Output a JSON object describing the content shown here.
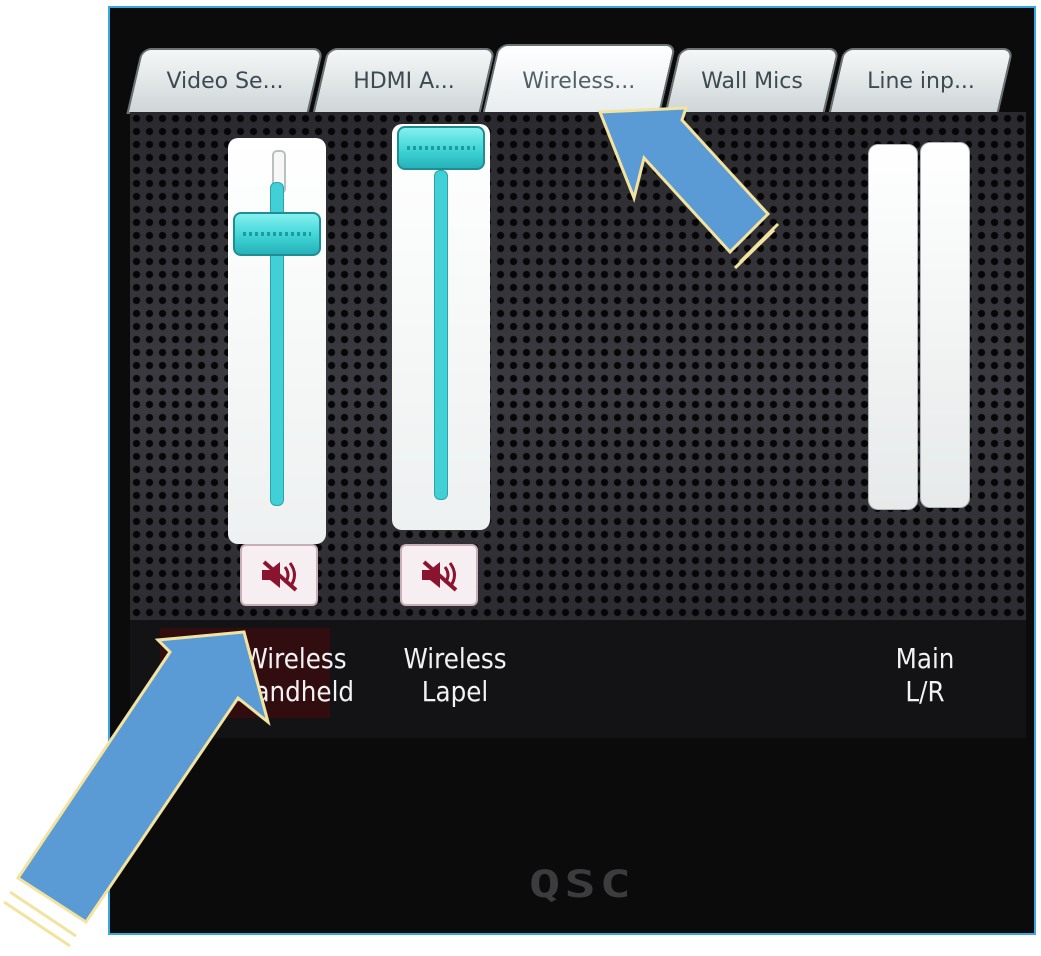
{
  "tabs": [
    {
      "label": "Video Se...",
      "active": false
    },
    {
      "label": "HDMI A...",
      "active": false
    },
    {
      "label": "Wireless...",
      "active": true
    },
    {
      "label": "Wall Mics",
      "active": false
    },
    {
      "label": "Line inp...",
      "active": false
    }
  ],
  "channels": [
    {
      "label_line1": "Wireless",
      "label_line2": "Handheld",
      "fader_level": 0.8,
      "mute_icon": "speaker-muted-icon"
    },
    {
      "label_line1": "Wireless",
      "label_line2": "Lapel",
      "fader_level": 1.0,
      "mute_icon": "speaker-muted-icon"
    }
  ],
  "main": {
    "label_line1": "Main",
    "label_line2": "L/R",
    "meter_left": 0,
    "meter_right": 0
  },
  "brand": {
    "logo_text": "QSC"
  },
  "annotations": [
    {
      "icon": "callout-arrow-icon",
      "points_to": "Wireless... tab"
    },
    {
      "icon": "callout-arrow-icon",
      "points_to": "Wireless Handheld channel label"
    }
  ],
  "colors": {
    "screen_border": "#3aa8e0",
    "fader_accent": "#40d0d6",
    "mute_icon": "#8a1330",
    "arrow_fill": "#5b9bd5",
    "arrow_stripe": "#f3e3a0"
  }
}
